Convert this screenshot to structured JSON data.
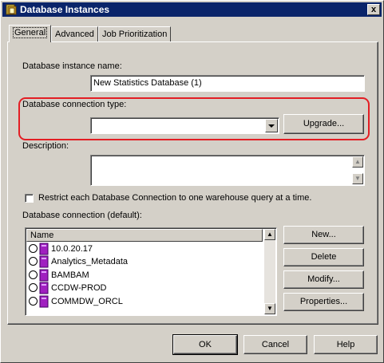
{
  "window": {
    "title": "Database Instances",
    "close": "x"
  },
  "tabs": [
    {
      "label": "General"
    },
    {
      "label": "Advanced"
    },
    {
      "label": "Job Prioritization"
    }
  ],
  "general": {
    "instance_name_label": "Database instance name:",
    "instance_name_value": "New Statistics Database (1)",
    "connection_type_label": "Database connection type:",
    "connection_type_value": "",
    "upgrade_button": "Upgrade...",
    "description_label": "Description:",
    "description_value": "",
    "restrict_checkbox_label": "Restrict each Database Connection to one warehouse query at a time.",
    "restrict_checked": false,
    "connection_default_label": "Database connection (default):",
    "connection_list": {
      "column": "Name",
      "items": [
        "10.0.20.17",
        "Analytics_Metadata",
        "BAMBAM",
        "CCDW-PROD",
        "COMMDW_ORCL"
      ]
    },
    "buttons": {
      "new": "New...",
      "delete": "Delete",
      "modify": "Modify...",
      "properties": "Properties..."
    }
  },
  "footer": {
    "ok": "OK",
    "cancel": "Cancel",
    "help": "Help"
  },
  "colors": {
    "titlebar": "#0a246a",
    "face": "#d4d0c8",
    "highlight": "#e31e24",
    "db_icon": "#a020c0"
  }
}
